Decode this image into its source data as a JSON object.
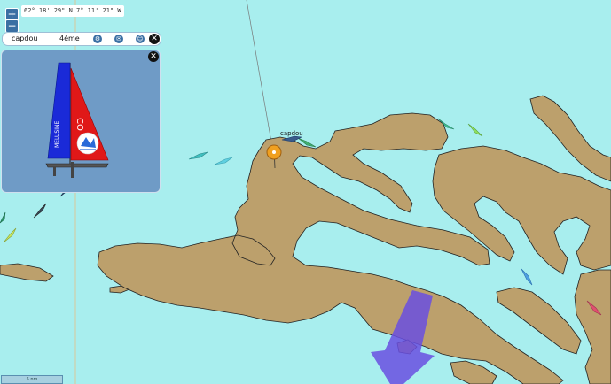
{
  "map": {
    "coordinates": "62° 18' 29\" N 7° 11' 21\" W",
    "scale_label": "5 nm",
    "own_boat_label": "capdou",
    "colors": {
      "sea": "#a8eeee",
      "land": "#bca06c",
      "current_arrow": "#6a4fe0",
      "own_marker": "#f0a020"
    }
  },
  "zoom": {
    "plus_label": "+",
    "minus_label": "−"
  },
  "info_bar": {
    "boat_name": "capdou",
    "rank": "4ème",
    "icons": [
      "settings-icon",
      "mail-icon",
      "user-icon"
    ],
    "close_label": "✕"
  },
  "boat_panel": {
    "sail_text": "MELUSINE",
    "close_label": "✕"
  }
}
